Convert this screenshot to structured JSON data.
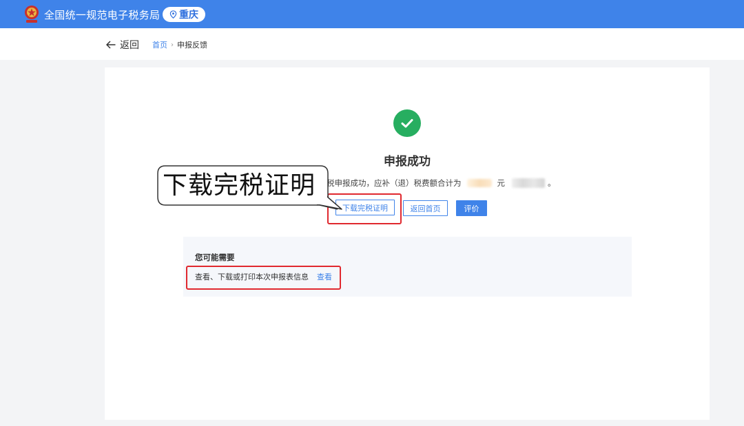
{
  "header": {
    "site_title": "全国统一规范电子税务局",
    "region": "重庆",
    "icons": [
      "national-emblem",
      "location-pin-icon"
    ]
  },
  "nav": {
    "back_label": "返回",
    "breadcrumb_home": "首页",
    "breadcrumb_separator": "›",
    "breadcrumb_current": "申报反馈"
  },
  "result": {
    "title": "申报成功",
    "message_prefix": "税申报成功，应补（退）税费额合计为",
    "currency_unit": "元",
    "message_suffix": "。",
    "status_color": "#27ae60"
  },
  "actions": {
    "download_label": "下载完税证明",
    "return_home_label": "返回首页",
    "evaluate_label": "评价"
  },
  "annotation": {
    "callout_text": "下载完税证明",
    "highlight_color": "#e0282e"
  },
  "suggestions": {
    "title": "您可能需要",
    "item_text": "查看、下载或打印本次申报表信息",
    "item_link": "查看"
  },
  "theme": {
    "brand_color": "#3f83e9"
  }
}
